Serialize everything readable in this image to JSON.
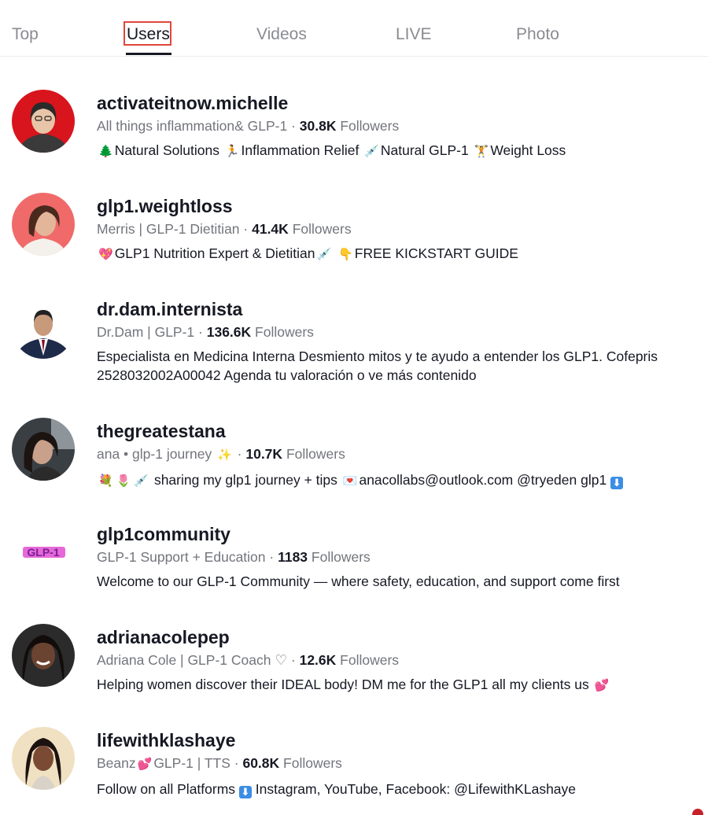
{
  "tabs": [
    {
      "label": "Top"
    },
    {
      "label": "Users"
    },
    {
      "label": "Videos"
    },
    {
      "label": "LIVE"
    },
    {
      "label": "Photo"
    }
  ],
  "active_tab": "Users",
  "users": [
    {
      "name": "activateitnow.michelle",
      "subtitle": "All things inflammation& GLP-1",
      "followers_count": "30.8K",
      "followers_label": "Followers",
      "bio": [
        "Natural Solutions",
        "Inflammation Relief",
        "Natural GLP-1",
        "Weight Loss"
      ],
      "emojis": [
        "🌲",
        "🏃",
        "💉",
        "🏋"
      ]
    },
    {
      "name": "glp1.weightloss",
      "subtitle": "Merris | GLP-1 Dietitian",
      "followers_count": "41.4K",
      "followers_label": "Followers",
      "bio": [
        "GLP1 Nutrition Expert & Dietitian",
        "FREE KICKSTART GUIDE"
      ],
      "emojis": [
        "💖",
        "💉",
        "👇"
      ]
    },
    {
      "name": "dr.dam.internista",
      "subtitle": "Dr.Dam | GLP-1",
      "followers_count": "136.6K",
      "followers_label": "Followers",
      "bio": "Especialista en Medicina Interna Desmiento mitos y te ayudo a entender los GLP1. Cofepris 2528032002A00042 Agenda tu valoración o ve más contenido"
    },
    {
      "name": "thegreatestana",
      "subtitle": "ana • glp-1 journey",
      "followers_count": "10.7K",
      "followers_label": "Followers",
      "bio": [
        "sharing my glp1 journey + tips",
        "anacollabs@outlook.com @tryeden glp1"
      ],
      "emojis": [
        "✨",
        "💐",
        "🌷",
        "💉",
        "💌",
        "⬇"
      ]
    },
    {
      "name": "glp1community",
      "subtitle": "GLP-1 Support + Education",
      "followers_count": "1183",
      "followers_label": "Followers",
      "bio": "Welcome to our GLP-1 Community — where safety, education, and support come first",
      "logo_text": "GLP-1"
    },
    {
      "name": "adrianacolepep",
      "subtitle": "Adriana Cole | GLP-1 Coach ♡",
      "followers_count": "12.6K",
      "followers_label": "Followers",
      "bio": "Helping women discover their IDEAL body! DM me for the GLP1 all my clients us",
      "emojis": [
        "💕"
      ]
    },
    {
      "name": "lifewithklashaye",
      "subtitle_pre": "Beanz",
      "subtitle_post": "GLP-1 | TTS",
      "followers_count": "60.8K",
      "followers_label": "Followers",
      "bio_pre": "Follow on all Platforms",
      "bio_post": "Instagram, YouTube, Facebook: @LifewithKLashaye",
      "emojis": [
        "💕",
        "⬇"
      ]
    }
  ],
  "colors": {
    "text_primary": "#161823",
    "text_secondary": "#73757c",
    "tab_inactive": "#8a8b91",
    "focus_outline": "#e0463c",
    "info_box_icon": "#3b8de5"
  }
}
